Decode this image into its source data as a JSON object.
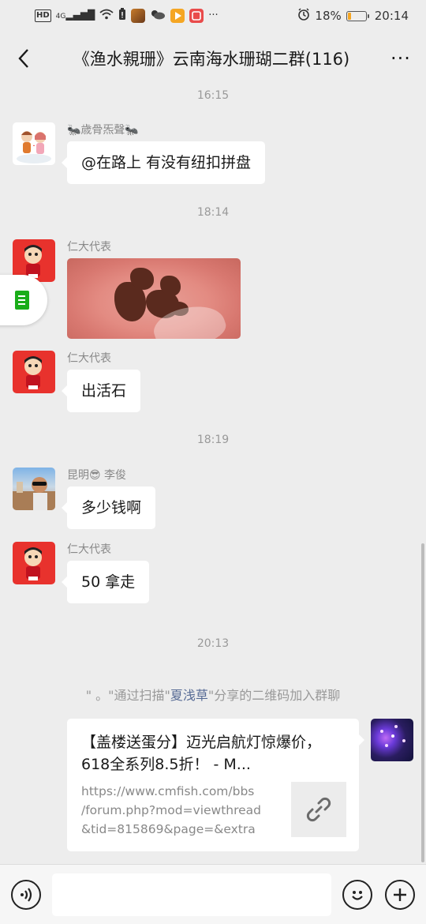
{
  "status_bar": {
    "left_icons": [
      "hd-icon",
      "signal-4g-icon",
      "wifi-icon",
      "battery-saver-icon",
      "game-app-icon",
      "weather-app-icon",
      "video-app-icon",
      "red-app-icon"
    ],
    "network_label": "4G",
    "more_label": "···",
    "battery_percent": "18%",
    "time": "20:14"
  },
  "navbar": {
    "back_icon": "chevron-left-icon",
    "title": "《渔水親珊》云南海水珊瑚二群(116)",
    "more_label": "···"
  },
  "messages": [
    {
      "type": "time",
      "text": "16:15"
    },
    {
      "type": "text",
      "sender": "🐜歳骨炁聲🐜",
      "text": "@在路上  有没有纽扣拼盘"
    },
    {
      "type": "time",
      "text": "18:14"
    },
    {
      "type": "image",
      "sender": "仁大代表"
    },
    {
      "type": "text",
      "sender": "仁大代表",
      "text": "出活石"
    },
    {
      "type": "time",
      "text": "18:19"
    },
    {
      "type": "text",
      "sender": "昆明😎 李俊",
      "text": "多少钱啊"
    },
    {
      "type": "text",
      "sender": "仁大代表",
      "text": "50 拿走"
    },
    {
      "type": "time",
      "text": "20:13"
    }
  ],
  "system_note": {
    "prefix": "\" 。\"通过扫描\"",
    "highlight": "夏浅草",
    "suffix": "\"分享的二维码加入群聊"
  },
  "link_card": {
    "title": "【盖楼送蛋分】迈光启航灯惊爆价，618全系列8.5折！ - M...",
    "description": "https://www.cmfish.com/bbs\n/forum.php?mod=viewthread\n&tid=815869&page=&extra=...",
    "thumb_icon": "link-icon"
  },
  "input_bar": {
    "voice_icon": "voice-icon",
    "emoji_icon": "emoji-icon",
    "plus_icon": "plus-icon"
  },
  "colors": {
    "background": "#ededed",
    "bubble": "#ffffff",
    "link_blue": "#576b95",
    "timestamp_gray": "#999999",
    "wechat_green": "#1aad19"
  }
}
